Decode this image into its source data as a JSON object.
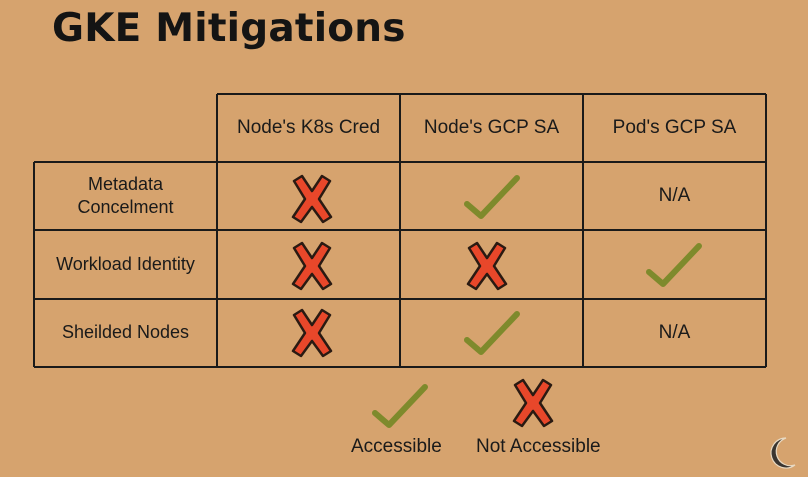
{
  "slide": {
    "title": "GKE Mitigations"
  },
  "table": {
    "columns": [
      "Node's K8s Cred",
      "Node's GCP SA",
      "Pod's GCP SA"
    ],
    "rows": [
      {
        "label": "Metadata Concelment",
        "cells": [
          "not-accessible",
          "accessible",
          "N/A"
        ]
      },
      {
        "label": "Workload Identity",
        "cells": [
          "not-accessible",
          "not-accessible",
          "accessible"
        ]
      },
      {
        "label": "Sheilded Nodes",
        "cells": [
          "not-accessible",
          "accessible",
          "N/A"
        ]
      }
    ],
    "na_text": "N/A"
  },
  "legend": {
    "accessible_label": "Accessible",
    "not_accessible_label": "Not Accessible"
  },
  "icons": {
    "accessible": "check-icon",
    "not_accessible": "x-icon",
    "logo": "crescent-moon-icon"
  },
  "colors": {
    "background": "#D6A36E",
    "check": "#7E8A2C",
    "x_fill": "#E8472A",
    "x_outline": "#2A1A12"
  }
}
